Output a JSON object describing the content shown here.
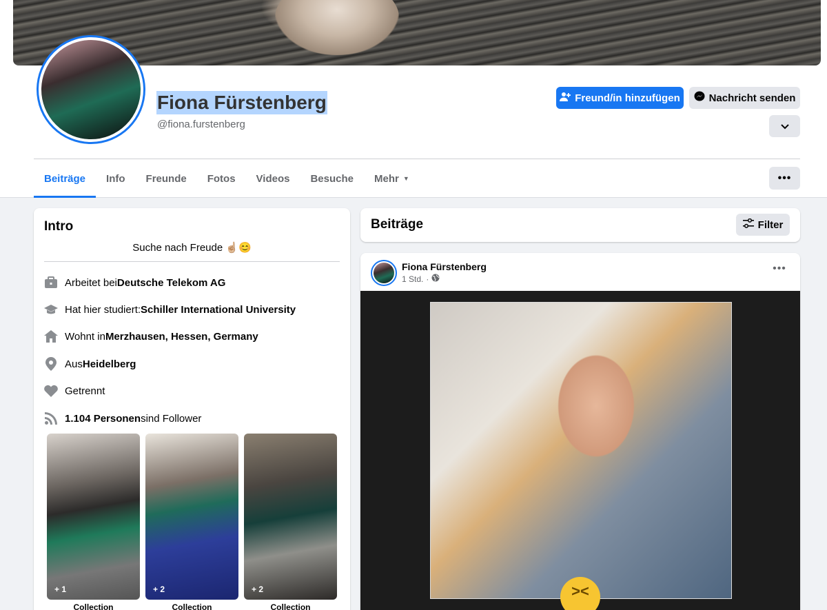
{
  "profile": {
    "name": "Fiona Fürstenberg",
    "handle": "@fiona.furstenberg"
  },
  "actions": {
    "add_friend": "Freund/in hinzufügen",
    "send_message": "Nachricht senden"
  },
  "tabs": [
    {
      "label": "Beiträge",
      "active": true
    },
    {
      "label": "Info"
    },
    {
      "label": "Freunde"
    },
    {
      "label": "Fotos"
    },
    {
      "label": "Videos"
    },
    {
      "label": "Besuche"
    },
    {
      "label": "Mehr"
    }
  ],
  "intro": {
    "title": "Intro",
    "bio": "Suche nach Freude ☝🏼😊",
    "items": [
      {
        "icon": "briefcase-icon",
        "prefix": "Arbeitet bei ",
        "bold": "Deutsche Telekom AG",
        "suffix": ""
      },
      {
        "icon": "graduation-cap-icon",
        "prefix": "Hat hier studiert: ",
        "bold": "Schiller International University",
        "suffix": ""
      },
      {
        "icon": "home-icon",
        "prefix": "Wohnt in ",
        "bold": "Merzhausen, Hessen, Germany",
        "suffix": ""
      },
      {
        "icon": "location-pin-icon",
        "prefix": "Aus ",
        "bold": "Heidelberg",
        "suffix": ""
      },
      {
        "icon": "heart-icon",
        "prefix": "Getrennt",
        "bold": "",
        "suffix": ""
      },
      {
        "icon": "rss-icon",
        "prefix": "",
        "bold": "1.104 Personen",
        "suffix": " sind Follower"
      }
    ],
    "photos": [
      {
        "count": "+ 1",
        "caption": "Collection"
      },
      {
        "count": "+ 2",
        "caption": "Collection"
      },
      {
        "count": "+ 2",
        "caption": "Collection"
      }
    ]
  },
  "posts": {
    "header": "Beiträge",
    "filter_label": "Filter",
    "post": {
      "author": "Fiona Fürstenberg",
      "time": "1 Std.",
      "separator": "·"
    }
  },
  "colors": {
    "accent": "#1877f2",
    "background": "#f0f2f5",
    "secondary_button": "#e4e6eb"
  }
}
